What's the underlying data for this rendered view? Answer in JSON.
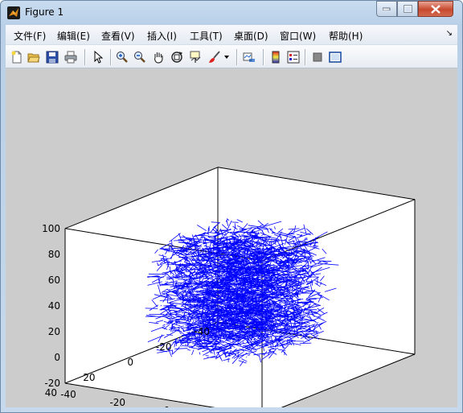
{
  "window": {
    "title": "Figure 1"
  },
  "menu": [
    {
      "id": "file",
      "label": "文件(F)"
    },
    {
      "id": "edit",
      "label": "编辑(E)"
    },
    {
      "id": "view",
      "label": "查看(V)"
    },
    {
      "id": "insert",
      "label": "插入(I)"
    },
    {
      "id": "tools",
      "label": "工具(T)"
    },
    {
      "id": "desktop",
      "label": "桌面(D)"
    },
    {
      "id": "window",
      "label": "窗口(W)"
    },
    {
      "id": "help",
      "label": "帮助(H)"
    }
  ],
  "toolbar": [
    "new-figure-icon",
    "open-file-icon",
    "save-icon",
    "print-icon",
    "select-arrow-icon",
    "zoom-in-icon",
    "zoom-out-icon",
    "pan-hand-icon",
    "rotate-3d-icon",
    "data-cursor-icon",
    "brush-icon",
    "link-plot-icon",
    "colorbar-icon",
    "legend-icon",
    "hide-plot-tools-icon",
    "show-plot-tools-icon"
  ],
  "colors": {
    "plot": "#0000ff",
    "figure_bg": "#cccccc",
    "axes_bg": "#ffffff"
  },
  "chart_data": {
    "type": "line3d",
    "grid": true,
    "series_color": "#0000ff",
    "x_ticks": [
      "-40",
      "-20",
      "0",
      "20",
      "40"
    ],
    "y_ticks": [
      "-40",
      "-20",
      "0",
      "20",
      "40"
    ],
    "z_ticks": [
      "-20",
      "0",
      "20",
      "40",
      "60",
      "80",
      "100"
    ],
    "xlim": [
      -40,
      40
    ],
    "ylim": [
      -40,
      40
    ],
    "zlim": [
      -20,
      100
    ],
    "data_extent": {
      "x": [
        -20,
        20
      ],
      "y": [
        -20,
        20
      ],
      "z": [
        0,
        80
      ]
    }
  }
}
